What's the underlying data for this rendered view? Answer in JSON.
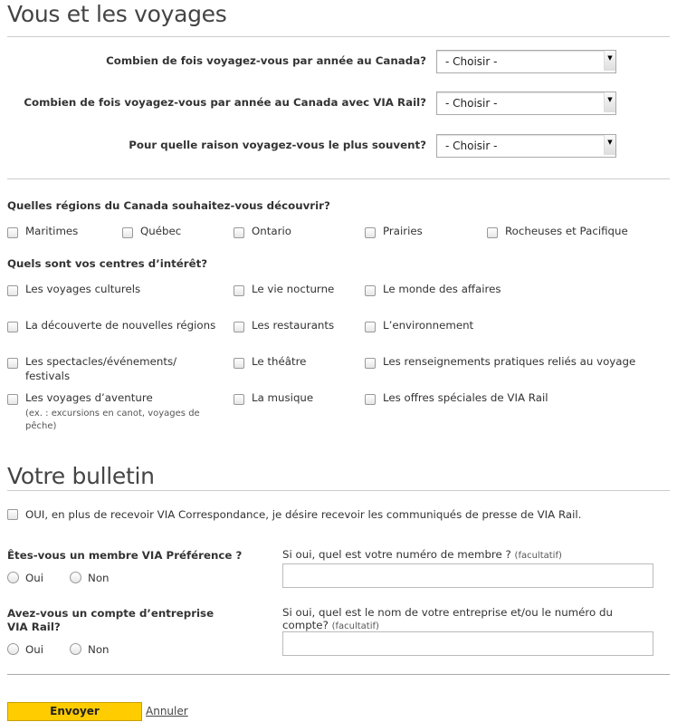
{
  "travel": {
    "title": "Vous et les voyages",
    "questions": [
      {
        "label": "Combien de fois voyagez-vous par année au Canada?",
        "value": "- Choisir -"
      },
      {
        "label": "Combien de fois voyagez-vous par année au Canada avec VIA Rail?",
        "value": "- Choisir -"
      },
      {
        "label": "Pour quelle raison voyagez-vous le plus souvent?",
        "value": "- Choisir -"
      }
    ],
    "regions_label": "Quelles régions du Canada souhaitez-vous découvrir?",
    "regions": [
      "Maritimes",
      "Québec",
      "Ontario",
      "Prairies",
      "Rocheuses et Pacifique"
    ],
    "interests_label": "Quels sont vos centres d’intérêt?",
    "interests": [
      "Les voyages culturels",
      "Le vie nocturne",
      "Le monde des affaires",
      "La découverte de nouvelles régions",
      "Les restaurants",
      "L’environnement",
      "Les spectacles/événements/",
      "Le théâtre",
      "Les renseignements pratiques reliés au voyage",
      "Les voyages d’aventure",
      "La musique",
      "Les offres spéciales de VIA Rail"
    ],
    "interest_cont": "festivals",
    "adventure_note": [
      "(ex. : excursions en canot, voyages de",
      "pêche)"
    ]
  },
  "bulletin": {
    "title": "Votre bulletin",
    "press_checkbox": "OUI, en plus de recevoir VIA Correspondance, je désire recevoir les communiqués de presse de VIA Rail.",
    "member_q": "Êtes-vous un membre VIA Préférence ?",
    "member_field": "Si oui, quel est votre numéro de membre ?",
    "optional": "(facultatif)",
    "business_q": [
      "Avez-vous un compte d’entreprise",
      "VIA Rail?"
    ],
    "business_field": [
      "Si oui, quel est le nom de votre entreprise et/ou le numéro du",
      "compte?"
    ],
    "yes": "Oui",
    "no": "Non"
  },
  "actions": {
    "submit": "Envoyer",
    "cancel": "Annuler",
    "accent": "#FFCC00"
  }
}
